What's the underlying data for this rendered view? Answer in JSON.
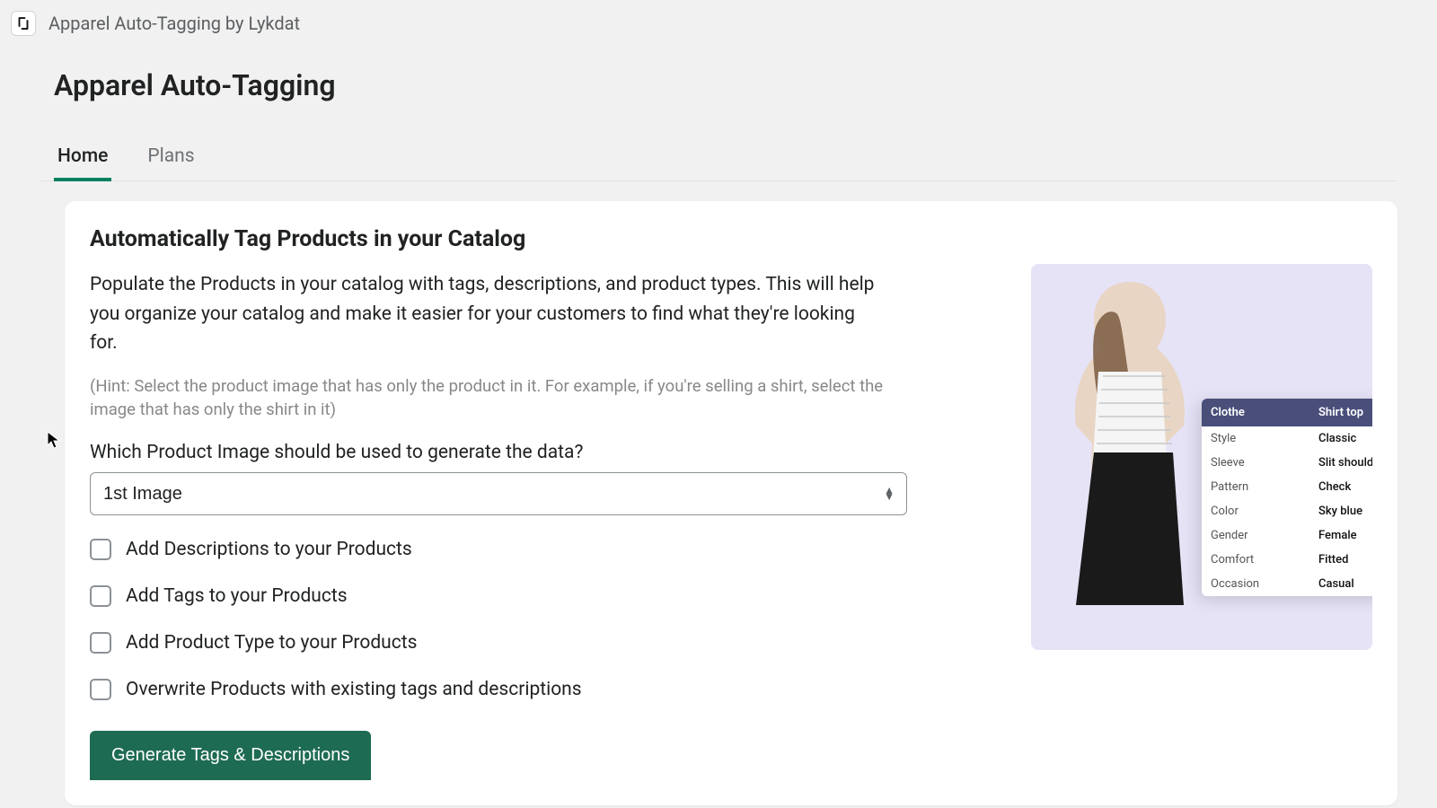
{
  "topbar": {
    "brand": "Apparel Auto-Tagging by Lykdat"
  },
  "page": {
    "title": "Apparel Auto-Tagging"
  },
  "tabs": [
    {
      "label": "Home",
      "active": true
    },
    {
      "label": "Plans",
      "active": false
    }
  ],
  "section": {
    "title": "Automatically Tag Products in your Catalog",
    "description": "Populate the Products in your catalog with tags, descriptions, and product types. This will help you organize your catalog and make it easier for your customers to find what they're looking for.",
    "hint": "(Hint: Select the product image that has only the product in it. For example, if you're selling a shirt, select the image that has only the shirt in it)",
    "select_label": "Which Product Image should be used to generate the data?",
    "select_value": "1st Image",
    "checkboxes": [
      {
        "label": "Add Descriptions to your Products",
        "checked": false
      },
      {
        "label": "Add Tags to your Products",
        "checked": false
      },
      {
        "label": "Add Product Type to your Products",
        "checked": false
      },
      {
        "label": "Overwrite Products with existing tags and descriptions",
        "checked": false
      }
    ],
    "submit_label": "Generate Tags & Descriptions"
  },
  "attribute_panel": {
    "header_key": "Clothe",
    "header_val": "Shirt top",
    "rows": [
      {
        "key": "Style",
        "val": "Classic"
      },
      {
        "key": "Sleeve",
        "val": "Slit shoulder"
      },
      {
        "key": "Pattern",
        "val": "Check"
      },
      {
        "key": "Color",
        "val": "Sky blue"
      },
      {
        "key": "Gender",
        "val": "Female"
      },
      {
        "key": "Comfort",
        "val": "Fitted"
      },
      {
        "key": "Occasion",
        "val": "Casual"
      }
    ]
  }
}
